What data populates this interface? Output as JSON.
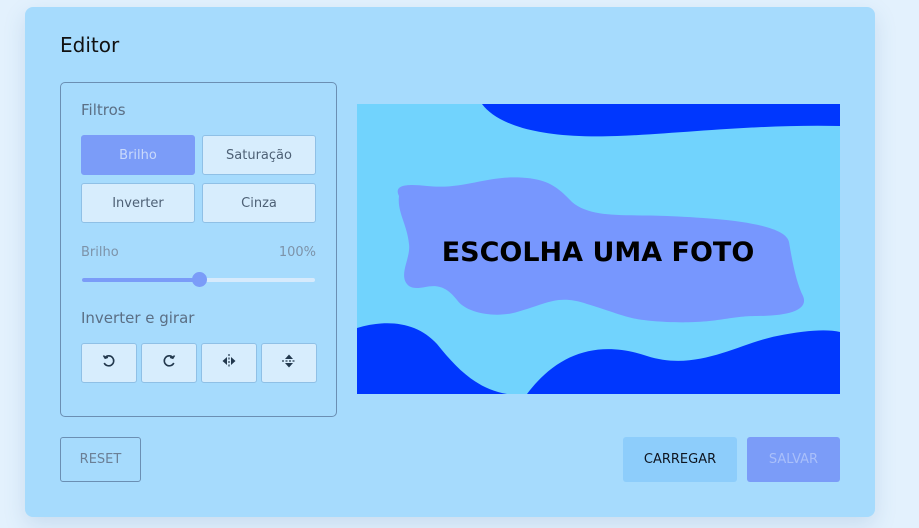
{
  "editor": {
    "title": "Editor"
  },
  "filters": {
    "heading": "Filtros",
    "buttons": [
      "Brilho",
      "Saturação",
      "Inverter",
      "Cinza"
    ],
    "active": "Brilho"
  },
  "slider": {
    "label": "Brilho",
    "value_text": "100%",
    "level": 0.5
  },
  "transform": {
    "heading": "Inverter e girar",
    "icons": [
      "rotate-left-icon",
      "rotate-right-icon",
      "flip-horizontal-icon",
      "flip-vertical-icon"
    ]
  },
  "preview": {
    "text": "ESCOLHA UMA FOTO"
  },
  "actions": {
    "reset": "RESET",
    "load": "CARREGAR",
    "save": "SALVAR"
  },
  "colors": {
    "card_bg": "#a6dbfd",
    "accent": "#7b9cf8",
    "preview_bg": "#71d3fd",
    "wave": "#0037fe"
  }
}
